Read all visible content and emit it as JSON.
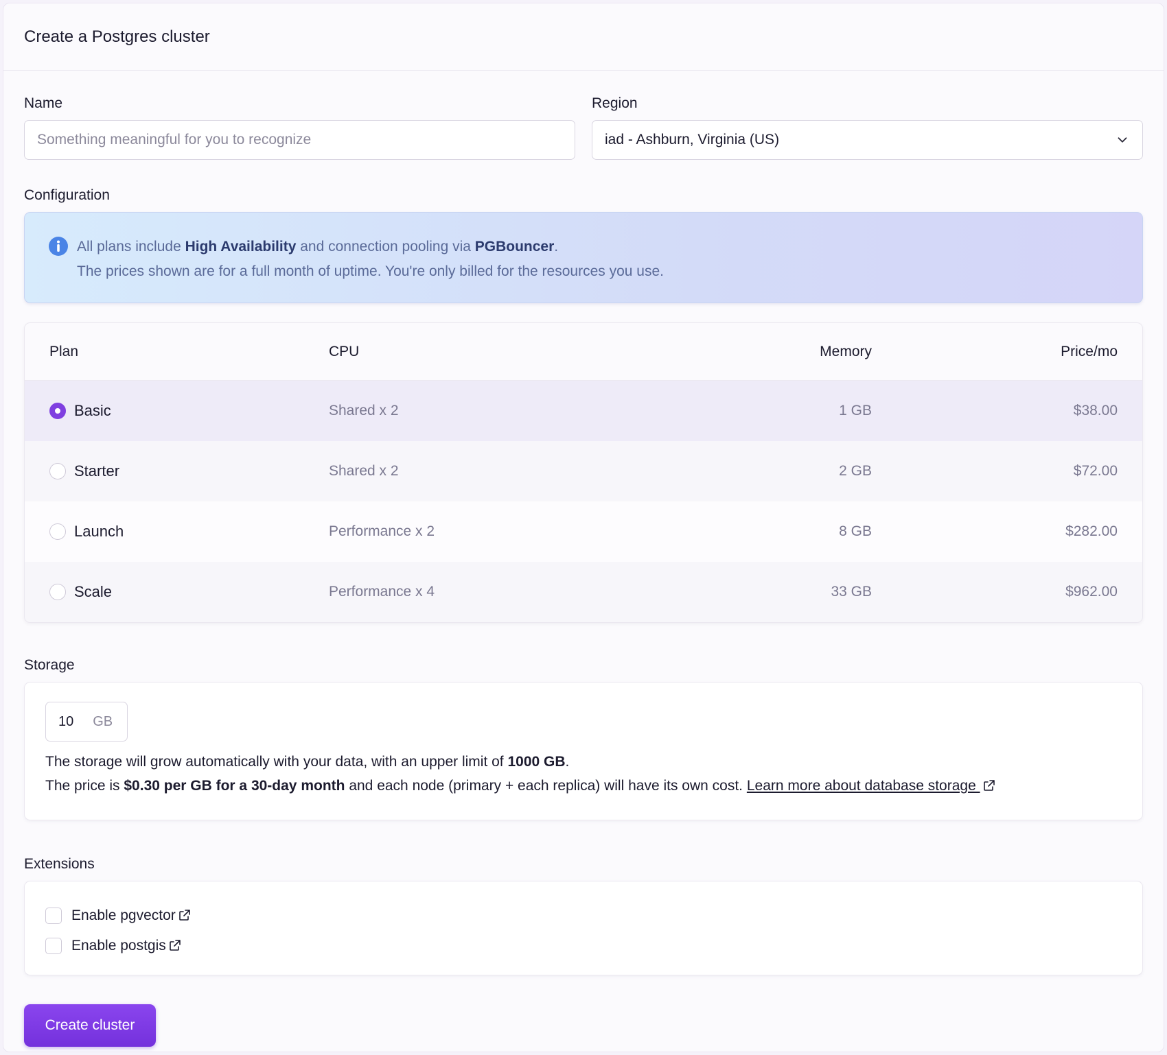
{
  "header": {
    "title": "Create a Postgres cluster"
  },
  "form": {
    "name_label": "Name",
    "name_placeholder": "Something meaningful for you to recognize",
    "name_value": "",
    "region_label": "Region",
    "region_value": "iad - Ashburn, Virginia (US)"
  },
  "configuration": {
    "label": "Configuration",
    "notice": {
      "line1_prefix": "All plans include ",
      "line1_bold1": "High Availability",
      "line1_mid": " and connection pooling via ",
      "line1_bold2": "PGBouncer",
      "line1_suffix": ".",
      "line2": "The prices shown are for a full month of uptime. You're only billed for the resources you use."
    },
    "columns": [
      "Plan",
      "CPU",
      "Memory",
      "Price/mo"
    ],
    "plans": [
      {
        "name": "Basic",
        "cpu": "Shared x 2",
        "memory": "1 GB",
        "price": "$38.00",
        "selected": true
      },
      {
        "name": "Starter",
        "cpu": "Shared x 2",
        "memory": "2 GB",
        "price": "$72.00",
        "selected": false
      },
      {
        "name": "Launch",
        "cpu": "Performance x 2",
        "memory": "8 GB",
        "price": "$282.00",
        "selected": false
      },
      {
        "name": "Scale",
        "cpu": "Performance x 4",
        "memory": "33 GB",
        "price": "$962.00",
        "selected": false
      }
    ]
  },
  "storage": {
    "label": "Storage",
    "value": "10",
    "unit": "GB",
    "line1_prefix": "The storage will grow automatically with your data, with an upper limit of ",
    "line1_bold": "1000 GB",
    "line1_suffix": ".",
    "line2_prefix": "The price is ",
    "line2_bold": "$0.30 per GB for a 30-day month",
    "line2_mid": " and each node (primary + each replica) will have its own cost. ",
    "link_text": "Learn more about database storage "
  },
  "extensions": {
    "label": "Extensions",
    "items": [
      {
        "label": "Enable pgvector",
        "checked": false
      },
      {
        "label": "Enable postgis",
        "checked": false
      }
    ]
  },
  "actions": {
    "create_label": "Create cluster"
  },
  "colors": {
    "accent": "#7f3fe0",
    "notice_text": "#5a6a98"
  }
}
